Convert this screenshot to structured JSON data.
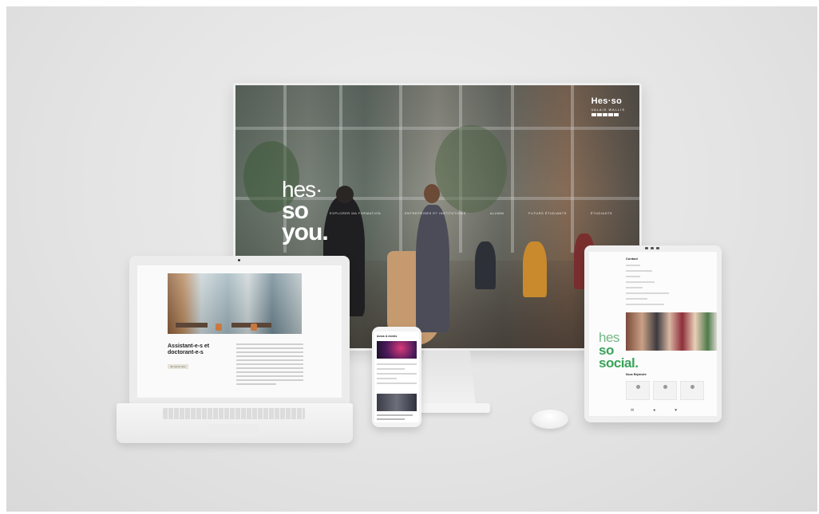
{
  "monitor": {
    "logo_main": "Hes·so",
    "logo_sub": "VALAIS WALLIS",
    "hero_line1": "hes·",
    "hero_line2": "so",
    "hero_line3": "you.",
    "nav": [
      "Explorer ma formation",
      "Entreprises et institutions",
      "Alumni",
      "Futurs étudiants",
      "Étudiants"
    ]
  },
  "laptop": {
    "title": "Assistant-e-s et doctorant-e-s",
    "button": "En savoir plus"
  },
  "phone": {
    "header": "Actus & events"
  },
  "tablet": {
    "contact_title": "Contact",
    "hero_line1": "hes",
    "hero_line2": "so",
    "hero_line3": "social.",
    "follow_title": "Nous Rejoindre"
  },
  "colors": {
    "background": "#e4e4e4",
    "accent_green": "#3aa35a",
    "wood": "#c59a6f"
  }
}
